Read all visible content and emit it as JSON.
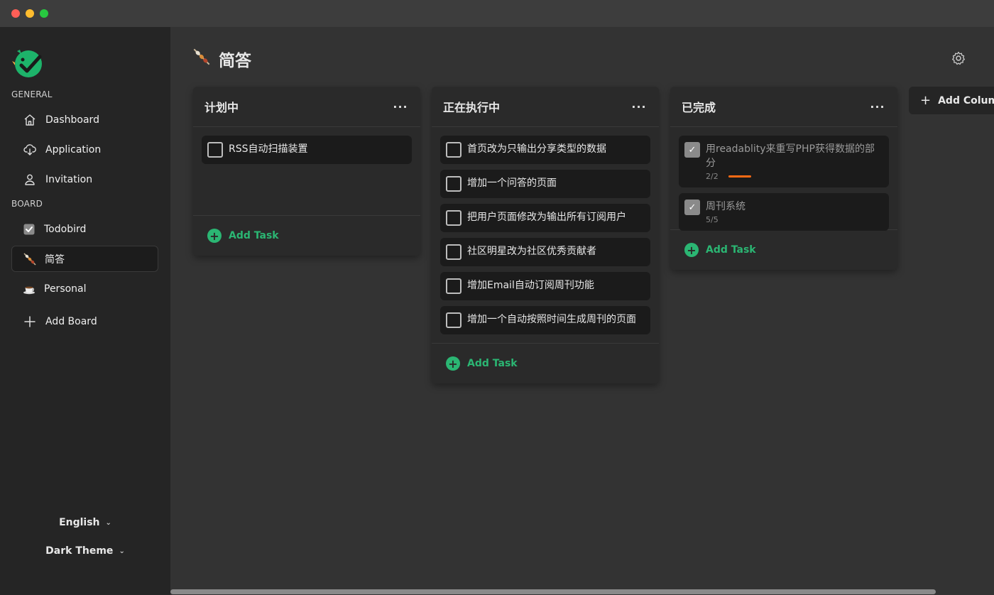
{
  "sidebar": {
    "general_label": "GENERAL",
    "board_label": "BOARD",
    "general_items": [
      {
        "label": "Dashboard",
        "icon": "home-icon"
      },
      {
        "label": "Application",
        "icon": "cloud-download-icon"
      },
      {
        "label": "Invitation",
        "icon": "user-icon"
      }
    ],
    "board_items": [
      {
        "label": "Todobird",
        "icon": "checkbox-icon"
      },
      {
        "label": "简答",
        "icon": "skewer-icon"
      },
      {
        "label": "Personal",
        "icon": "coffee-icon"
      }
    ],
    "add_board_label": "Add Board",
    "language": "English",
    "theme": "Dark Theme"
  },
  "board": {
    "title": "简答",
    "add_column_label": "Add Column",
    "columns": [
      {
        "title": "计划中",
        "add_task_label": "Add Task",
        "tasks": [
          {
            "text": "RSS自动扫描装置",
            "done": false
          }
        ]
      },
      {
        "title": "正在执行中",
        "add_task_label": "Add Task",
        "tasks": [
          {
            "text": "首页改为只输出分享类型的数据",
            "done": false
          },
          {
            "text": "增加一个问答的页面",
            "done": false
          },
          {
            "text": "把用户页面修改为输出所有订阅用户",
            "done": false
          },
          {
            "text": "社区明星改为社区优秀贡献者",
            "done": false
          },
          {
            "text": "增加Email自动订阅周刊功能",
            "done": false
          },
          {
            "text": "增加一个自动按照时间生成周刊的页面",
            "done": false
          }
        ]
      },
      {
        "title": "已完成",
        "add_task_label": "Add Task",
        "tasks": [
          {
            "text": "用readablity来重写PHP获得数据的部分",
            "done": true,
            "subtasks": "2/2",
            "progress": 1.0
          },
          {
            "text": "周刊系统",
            "done": true,
            "subtasks": "5/5"
          }
        ]
      }
    ]
  },
  "colors": {
    "accent_green": "#2bb673",
    "progress_orange": "#ff6a14"
  }
}
